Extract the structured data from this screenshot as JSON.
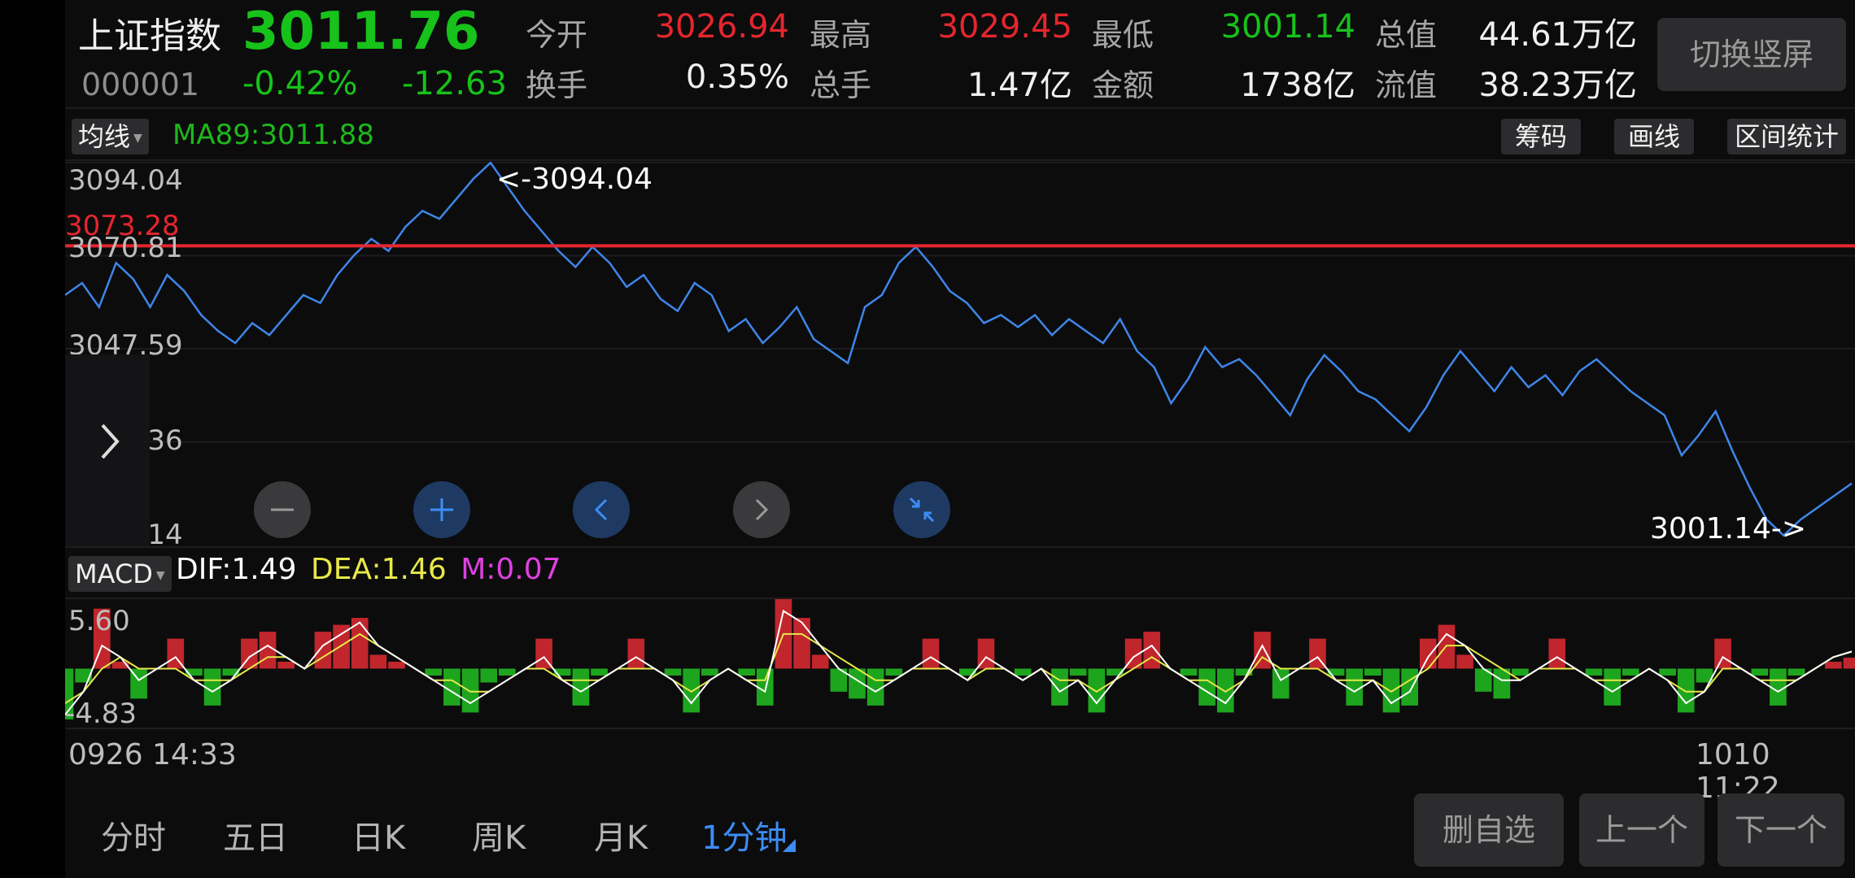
{
  "header": {
    "name": "上证指数",
    "code": "000001",
    "price": "3011.76",
    "change_pct": "-0.42%",
    "change": "-12.63",
    "stats": [
      {
        "label": "今开",
        "value": "3026.94",
        "color": "red"
      },
      {
        "label": "最高",
        "value": "3029.45",
        "color": "red"
      },
      {
        "label": "最低",
        "value": "3001.14",
        "color": "green"
      },
      {
        "label": "总值",
        "value": "44.61万亿",
        "color": "white"
      },
      {
        "label": "换手",
        "value": "0.35%",
        "color": "white"
      },
      {
        "label": "总手",
        "value": "1.47亿",
        "color": "white"
      },
      {
        "label": "金额",
        "value": "1738亿",
        "color": "white"
      },
      {
        "label": "流值",
        "value": "38.23万亿",
        "color": "white"
      }
    ],
    "switch_button": "切换竖屏"
  },
  "toolbar": {
    "indicator_select": "均线",
    "ma_label": "MA89:3011.88",
    "buttons": [
      "筹码",
      "画线",
      "区间统计"
    ]
  },
  "price_chart": {
    "y_labels": [
      "3094.04",
      "3070.81",
      "3047.59",
      "3024.36",
      "3001.14"
    ],
    "ref_line_value": "3073.28",
    "high_marker": "<-3094.04",
    "low_marker": "3001.14->",
    "expand_icon": "chevron-right-icon"
  },
  "macd": {
    "indicator_select": "MACD",
    "dif": "DIF:1.49",
    "dea": "DEA:1.46",
    "m": "M:0.07",
    "y_top": "5.60",
    "y_bottom": "-4.83"
  },
  "time_axis": {
    "start": "0926 14:33",
    "end": "1010 11:22"
  },
  "tabs": [
    "分时",
    "五日",
    "日K",
    "周K",
    "月K",
    "1分钟"
  ],
  "active_tab": "1分钟",
  "bottom_buttons": [
    "删自选",
    "上一个",
    "下一个"
  ],
  "colors": {
    "up": "#e5262d",
    "down": "#17c21a",
    "line": "#3e86e8",
    "dif": "#ffffff",
    "dea": "#e8e84a",
    "m": "#e040e0",
    "accent": "#3d8df4"
  },
  "chart_data": {
    "type": "line",
    "title": "",
    "xlabel": "",
    "ylabel": "",
    "ylim": [
      3001.14,
      3094.04
    ],
    "x_range": [
      "0926 14:33",
      "1010 11:22"
    ],
    "series": [
      {
        "values": [
          3061,
          3064,
          3058,
          3069,
          3065,
          3058,
          3066,
          3062,
          3056,
          3052,
          3049,
          3054,
          3051,
          3056,
          3061,
          3059,
          3066,
          3071,
          3075,
          3072,
          3078,
          3082,
          3080,
          3085,
          3090,
          3094,
          3088,
          3082,
          3077,
          3072,
          3068,
          3073,
          3069,
          3063,
          3066,
          3060,
          3057,
          3064,
          3061,
          3052,
          3055,
          3049,
          3053,
          3058,
          3050,
          3047,
          3044,
          3058,
          3061,
          3069,
          3073,
          3068,
          3062,
          3059,
          3054,
          3056,
          3053,
          3056,
          3051,
          3055,
          3052,
          3049,
          3055,
          3047,
          3043,
          3034,
          3040,
          3048,
          3043,
          3045,
          3041,
          3036,
          3031,
          3040,
          3046,
          3042,
          3037,
          3035,
          3031,
          3027,
          3033,
          3041,
          3047,
          3042,
          3037,
          3043,
          3038,
          3041,
          3036,
          3042,
          3045,
          3041,
          3037,
          3034,
          3031,
          3021,
          3026,
          3032,
          3022,
          3013,
          3005,
          3001,
          3005,
          3008,
          3011,
          3014
        ]
      }
    ],
    "ref_line": 3073.28,
    "macd": {
      "ylim": [
        -4.83,
        5.6
      ],
      "dif": [
        -4,
        -2,
        2,
        1,
        -1,
        0,
        1,
        -1,
        -2,
        -1,
        1,
        2,
        1,
        0,
        2,
        3,
        4,
        2,
        1,
        0,
        -1,
        -2,
        -3,
        -2,
        -1,
        0,
        1,
        -1,
        -2,
        -1,
        0,
        1,
        0,
        -1,
        -3,
        -1,
        0,
        -1,
        -2,
        5,
        4,
        2,
        0,
        -1,
        -2,
        -1,
        0,
        1,
        0,
        -1,
        1,
        0,
        -1,
        0,
        -2,
        -1,
        -3,
        -1,
        1,
        2,
        0,
        -1,
        -2,
        -3,
        -1,
        2,
        -1,
        0,
        1,
        -1,
        -2,
        -1,
        -3,
        -2,
        1,
        3,
        2,
        0,
        -1,
        -1,
        0,
        1,
        0,
        -1,
        -2,
        -1,
        0,
        -1,
        -3,
        -2,
        1,
        0,
        -1,
        -2,
        -1,
        0,
        1,
        1.49
      ],
      "dea": [
        -3,
        -2,
        0,
        1,
        0,
        0,
        0,
        -1,
        -1,
        -1,
        0,
        1,
        1,
        0,
        1,
        2,
        3,
        2,
        1,
        0,
        -1,
        -1,
        -2,
        -2,
        -1,
        0,
        0,
        -1,
        -1,
        -1,
        0,
        0,
        0,
        -1,
        -2,
        -1,
        0,
        -1,
        -1,
        3,
        3,
        2,
        1,
        0,
        -1,
        -1,
        0,
        0,
        0,
        -1,
        0,
        0,
        -1,
        0,
        -1,
        -1,
        -2,
        -1,
        0,
        1,
        0,
        -1,
        -1,
        -2,
        -1,
        1,
        0,
        0,
        0,
        -1,
        -1,
        -1,
        -2,
        -1,
        0,
        2,
        2,
        1,
        0,
        -1,
        0,
        0,
        0,
        -1,
        -1,
        -1,
        0,
        -1,
        -2,
        -2,
        0,
        0,
        -1,
        -1,
        -1,
        0,
        1,
        1.46
      ]
    }
  }
}
